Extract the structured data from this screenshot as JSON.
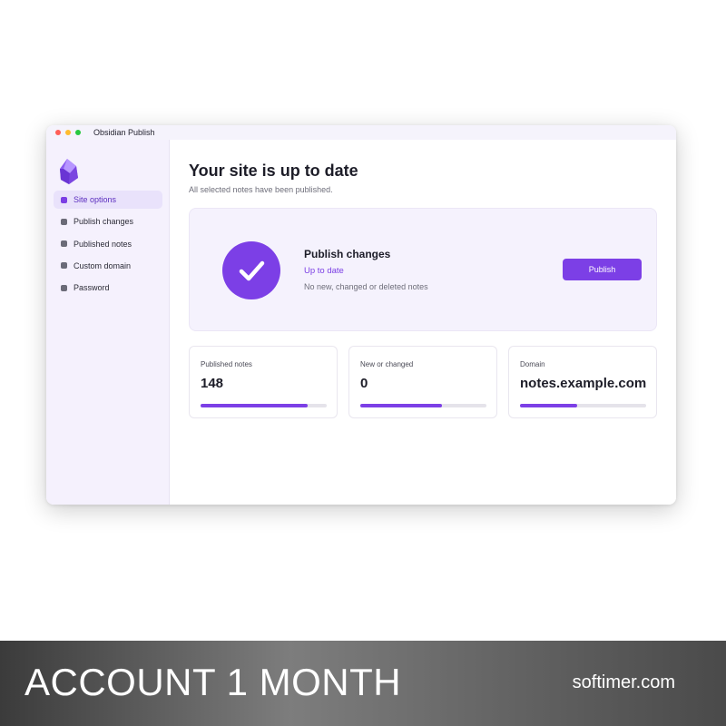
{
  "window": {
    "title": "Obsidian Publish"
  },
  "sidebar": {
    "items": [
      {
        "label": "Site options",
        "active": true
      },
      {
        "label": "Publish changes",
        "active": false
      },
      {
        "label": "Published notes",
        "active": false
      },
      {
        "label": "Custom domain",
        "active": false
      },
      {
        "label": "Password",
        "active": false
      }
    ]
  },
  "main": {
    "heading": "Your site is up to date",
    "subheading": "All selected notes have been published.",
    "status_card": {
      "title": "Publish changes",
      "status": "Up to date",
      "detail": "No new, changed or deleted notes",
      "button_label": "Publish"
    },
    "stats": [
      {
        "label": "Published notes",
        "value": "148",
        "progress": 0.85
      },
      {
        "label": "New or changed",
        "value": "0",
        "progress": 0.65
      },
      {
        "label": "Domain",
        "value": "notes.example.com",
        "progress": 0.45
      }
    ]
  },
  "banner": {
    "title": "ACCOUNT 1 MONTH",
    "site": "softimer.com"
  },
  "colors": {
    "accent": "#7c3fe6",
    "sidebar_bg": "#f5f1fd",
    "card_bg": "#f5f2fd"
  },
  "icons": {
    "logo": "obsidian-crystal-icon",
    "status": "checkmark-icon",
    "nav_bullet": "square-bullet-icon"
  }
}
